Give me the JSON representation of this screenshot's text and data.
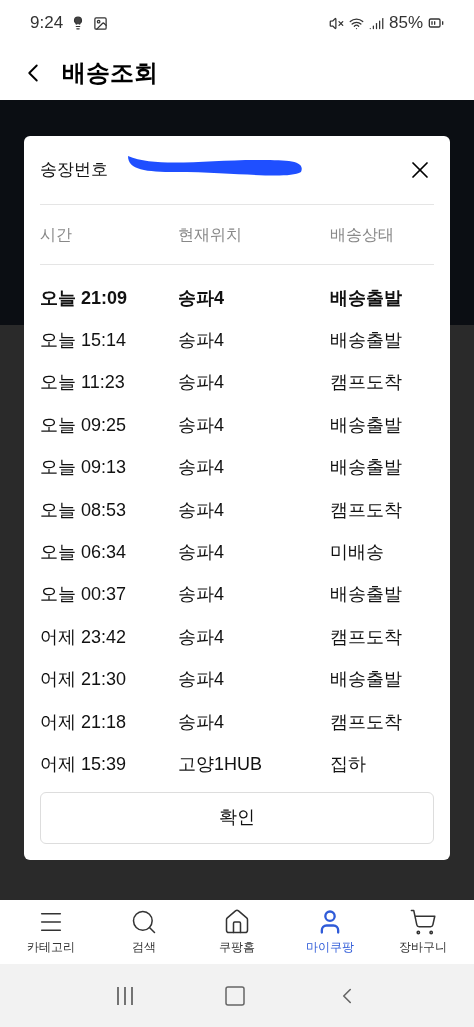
{
  "status_bar": {
    "time": "9:24",
    "battery": "85%"
  },
  "header": {
    "title": "배송조회"
  },
  "dialog": {
    "title": "송장번호",
    "columns": [
      "시간",
      "현재위치",
      "배송상태"
    ],
    "rows": [
      {
        "time": "오늘 21:09",
        "location": "송파4",
        "status": "배송출발",
        "latest": true
      },
      {
        "time": "오늘 15:14",
        "location": "송파4",
        "status": "배송출발",
        "latest": false
      },
      {
        "time": "오늘 11:23",
        "location": "송파4",
        "status": "캠프도착",
        "latest": false
      },
      {
        "time": "오늘 09:25",
        "location": "송파4",
        "status": "배송출발",
        "latest": false
      },
      {
        "time": "오늘 09:13",
        "location": "송파4",
        "status": "배송출발",
        "latest": false
      },
      {
        "time": "오늘 08:53",
        "location": "송파4",
        "status": "캠프도착",
        "latest": false
      },
      {
        "time": "오늘 06:34",
        "location": "송파4",
        "status": "미배송",
        "latest": false
      },
      {
        "time": "오늘 00:37",
        "location": "송파4",
        "status": "배송출발",
        "latest": false
      },
      {
        "time": "어제 23:42",
        "location": "송파4",
        "status": "캠프도착",
        "latest": false
      },
      {
        "time": "어제 21:30",
        "location": "송파4",
        "status": "배송출발",
        "latest": false
      },
      {
        "time": "어제 21:18",
        "location": "송파4",
        "status": "캠프도착",
        "latest": false
      },
      {
        "time": "어제 15:39",
        "location": "고양1HUB",
        "status": "집하",
        "latest": false
      }
    ],
    "confirm_button": "확인"
  },
  "bottom_nav": [
    {
      "kind": "menu",
      "label": "카테고리",
      "selected": false
    },
    {
      "kind": "search",
      "label": "검색",
      "selected": false
    },
    {
      "kind": "home",
      "label": "쿠팡홈",
      "selected": false
    },
    {
      "kind": "user",
      "label": "마이쿠팡",
      "selected": true
    },
    {
      "kind": "cart",
      "label": "장바구니",
      "selected": false
    }
  ]
}
